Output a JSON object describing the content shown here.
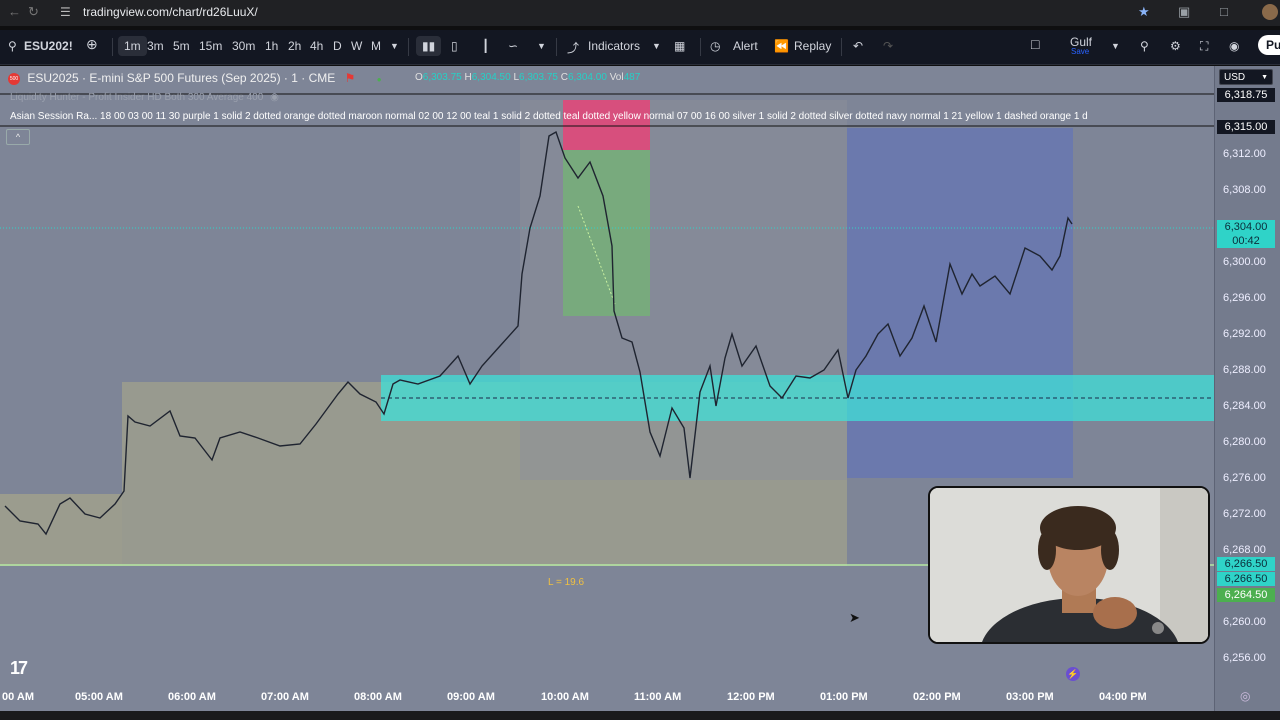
{
  "browser": {
    "url": "tradingview.com/chart/rd26LuuX/",
    "back_icon": "back-arrow-icon",
    "reload_icon": "reload-icon"
  },
  "toolbar": {
    "search_label": "ESU202!",
    "intervals": [
      "1m",
      "3m",
      "5m",
      "15m",
      "30m",
      "1h",
      "2h",
      "4h",
      "D",
      "W",
      "M"
    ],
    "active_interval": "1m",
    "indicators_label": "Indicators",
    "alert_label": "Alert",
    "replay_label": "Replay",
    "layout_name": "Gulf",
    "layout_sub": "Save",
    "publish_label": "Pu"
  },
  "legend": {
    "logo_text": "500",
    "symbol": "ESU2025 · E-mini S&P 500 Futures (Sep 2025) · 1 · CME",
    "o_label": "O",
    "o": "6,303.75",
    "h_label": "H",
    "h": "6,304.50",
    "l_label": "L",
    "l": "6,303.75",
    "c_label": "C",
    "c": "6,304.00",
    "vol_label": "Vol",
    "vol": "487",
    "indicator1": "Liquidity Hunter - Profit Insider HD Both 300 Average 400",
    "indicator2": "Asian Session Ra... 18 00 03 00 11 30 purple 1 solid 2 dotted orange dotted maroon normal 02 00 12 00 teal 1 solid 2 dotted teal dotted yellow normal 07 00 16 00 silver 1 solid 2 dotted silver dotted navy normal 1 21 yellow 1 dashed orange 1 d",
    "collapse": "^"
  },
  "annotation": {
    "l_text": "L = 19.6"
  },
  "price_axis": {
    "currency": "USD",
    "labels": [
      "6,312.00",
      "6,308.00",
      "6,300.00",
      "6,296.00",
      "6,292.00",
      "6,288.00",
      "6,284.00",
      "6,280.00",
      "6,276.00",
      "6,272.00",
      "6,268.00",
      "6,260.00",
      "6,256.00"
    ],
    "tag_top1": "6,318.75",
    "tag_top2": "6,315.00",
    "current_price": "6,304.00",
    "countdown": "00:42",
    "tag_a": "6,266.50",
    "tag_b": "6,266.50",
    "tag_c": "6,264.50"
  },
  "time_axis": {
    "labels": [
      "00 AM",
      "05:00 AM",
      "06:00 AM",
      "07:00 AM",
      "08:00 AM",
      "09:00 AM",
      "10:00 AM",
      "11:00 AM",
      "12:00 PM",
      "01:00 PM",
      "02:00 PM",
      "03:00 PM",
      "04:00 PM"
    ]
  },
  "colors": {
    "chart_bg": "#7e8597",
    "teal_zone": "#3fe0d8",
    "green_zone": "#6fbf6a",
    "red_zone": "#e0487a",
    "blue_session": "#5b6fbf",
    "olive_zone": "#b8b486",
    "price_tag": "#2fd3c8",
    "green_tag": "#4caf50"
  }
}
